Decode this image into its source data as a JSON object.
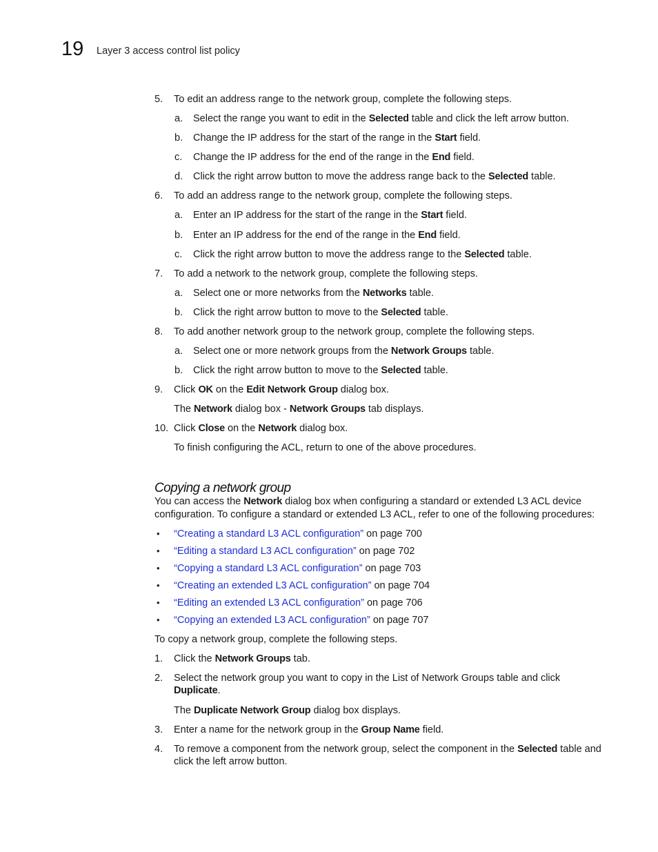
{
  "header": {
    "chapter_number": "19",
    "chapter_title": "Layer 3 access control list policy"
  },
  "steps_top": [
    {
      "num": "5.",
      "parts": [
        "To edit an address range to the network group, complete the following steps."
      ]
    },
    {
      "sub": "a.",
      "parts": [
        "Select the range you want to edit in the ",
        "Selected",
        " table and click the left arrow button."
      ]
    },
    {
      "sub": "b.",
      "parts": [
        "Change the IP address for the start of the range in the ",
        "Start",
        " field."
      ]
    },
    {
      "sub": "c.",
      "parts": [
        "Change the IP address for the end of the range in the ",
        "End",
        " field."
      ]
    },
    {
      "sub": "d.",
      "parts": [
        "Click the right arrow button to move the address range back to the ",
        "Selected",
        " table."
      ]
    },
    {
      "num": "6.",
      "parts": [
        "To add an address range to the network group, complete the following steps."
      ]
    },
    {
      "sub": "a.",
      "parts": [
        "Enter an IP address for the start of the range in the ",
        "Start",
        " field."
      ]
    },
    {
      "sub": "b.",
      "parts": [
        "Enter an IP address for the end of the range in the ",
        "End",
        " field."
      ]
    },
    {
      "sub": "c.",
      "parts": [
        "Click the right arrow button to move the address range to the ",
        "Selected",
        " table."
      ]
    },
    {
      "num": "7.",
      "parts": [
        "To add a network to the network group, complete the following steps."
      ]
    },
    {
      "sub": "a.",
      "parts": [
        "Select one or more networks from the ",
        "Networks",
        " table."
      ]
    },
    {
      "sub": "b.",
      "parts": [
        "Click the right arrow button to move to the ",
        "Selected",
        " table."
      ]
    },
    {
      "num": "8.",
      "parts": [
        "To add another network group to the network group, complete the following steps."
      ]
    },
    {
      "sub": "a.",
      "parts": [
        "Select one or more network groups from the ",
        "Network Groups",
        " table."
      ]
    },
    {
      "sub": "b.",
      "parts": [
        "Click the right arrow button to move to the ",
        "Selected",
        " table."
      ]
    },
    {
      "num": "9.",
      "parts": [
        "Click ",
        "OK",
        " on the ",
        "Edit Network Group",
        " dialog box."
      ]
    },
    {
      "cont": true,
      "parts": [
        "The ",
        "Network",
        " dialog box - ",
        "Network Groups",
        " tab displays."
      ]
    },
    {
      "num": "10.",
      "parts": [
        "Click ",
        "Close",
        " on the ",
        "Network",
        " dialog box."
      ]
    },
    {
      "cont": true,
      "parts": [
        "To finish configuring the ACL, return to one of the above procedures."
      ]
    }
  ],
  "section": {
    "heading": "Copying a network group",
    "intro_parts": [
      "You can access the ",
      "Network",
      " dialog box when configuring a standard or extended L3 ACL device configuration. To configure a standard or extended L3 ACL, refer to one of the following procedures:"
    ],
    "links": [
      {
        "text": "“Creating a standard L3 ACL configuration”",
        "suffix": " on page 700"
      },
      {
        "text": "“Editing a standard L3 ACL configuration”",
        "suffix": " on page 702"
      },
      {
        "text": "“Copying a standard L3 ACL configuration”",
        "suffix": " on page 703"
      },
      {
        "text": "“Creating an extended L3 ACL configuration”",
        "suffix": " on page 704"
      },
      {
        "text": "“Editing an extended L3 ACL configuration”",
        "suffix": " on page 706"
      },
      {
        "text": "“Copying an extended L3 ACL configuration”",
        "suffix": " on page 707"
      }
    ],
    "bullet": "•",
    "lead": "To copy a network group, complete the following steps.",
    "steps": [
      {
        "num": "1.",
        "parts": [
          "Click the ",
          "Network Groups",
          " tab."
        ]
      },
      {
        "num": "2.",
        "parts": [
          "Select the network group you want to copy in the List of Network Groups table and click ",
          "Duplicate",
          "."
        ]
      },
      {
        "cont": true,
        "parts": [
          "The ",
          "Duplicate Network Group",
          " dialog box displays."
        ]
      },
      {
        "num": "3.",
        "parts": [
          "Enter a name for the network group in the ",
          "Group Name",
          " field."
        ]
      },
      {
        "num": "4.",
        "parts": [
          "To remove a component from the network group, select the component in the ",
          "Selected",
          " table and click the left arrow button."
        ]
      }
    ]
  },
  "colors": {
    "link": "#1f2fd6",
    "text": "#1a1a1a"
  }
}
